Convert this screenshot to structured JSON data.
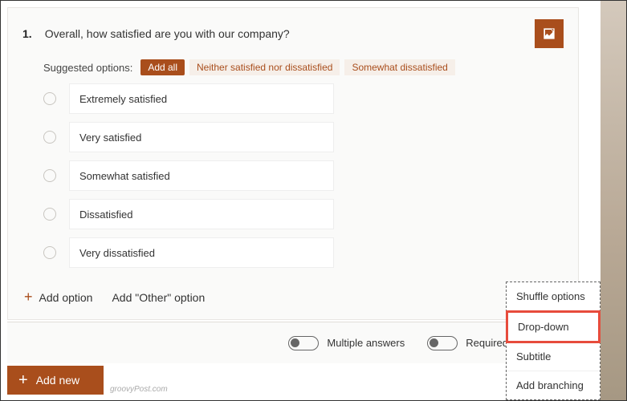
{
  "question": {
    "number": "1.",
    "text": "Overall, how satisfied are you with our company?"
  },
  "suggested": {
    "label": "Suggested options:",
    "add_all": "Add all",
    "chips": [
      "Neither satisfied nor dissatisfied",
      "Somewhat dissatisfied"
    ]
  },
  "options": [
    "Extremely satisfied",
    "Very satisfied",
    "Somewhat satisfied",
    "Dissatisfied",
    "Very dissatisfied"
  ],
  "add_option": "Add option",
  "add_other": "Add \"Other\" option",
  "toggles": {
    "multiple": "Multiple answers",
    "required": "Required"
  },
  "menu": {
    "shuffle": "Shuffle options",
    "dropdown": "Drop-down",
    "subtitle": "Subtitle",
    "branching": "Add branching"
  },
  "add_new": "Add new",
  "watermark": "groovyPost.com"
}
